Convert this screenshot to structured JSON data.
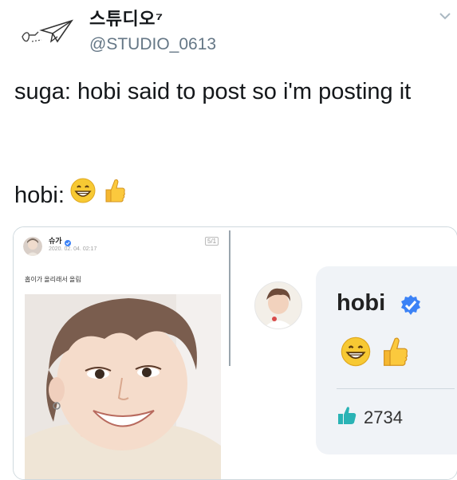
{
  "tweet": {
    "display_name": "스튜디오⁷",
    "handle": "@STUDIO_0613",
    "text": "suga: hobi said to post so i'm posting it",
    "hobi_prefix": "hobi:"
  },
  "screenshot_left": {
    "user_name": "슈가",
    "date": "2020. 02. 04. 02:17",
    "page_indicator": "5/1",
    "post_text": "홉이가 올리래서 올림"
  },
  "screenshot_right": {
    "commenter": "hobi",
    "likes": "2734"
  },
  "icons": {
    "avatar": "paper-plane-doodle-icon",
    "chevron": "chevron-down-icon",
    "grin": "grinning-face-icon",
    "thumbs": "thumbs-up-icon",
    "verified": "verified-badge-icon",
    "like": "like-thumb-icon"
  },
  "colors": {
    "verified": "#3c82f6",
    "like": "#2ab3b5",
    "secondary_text": "#657786"
  }
}
